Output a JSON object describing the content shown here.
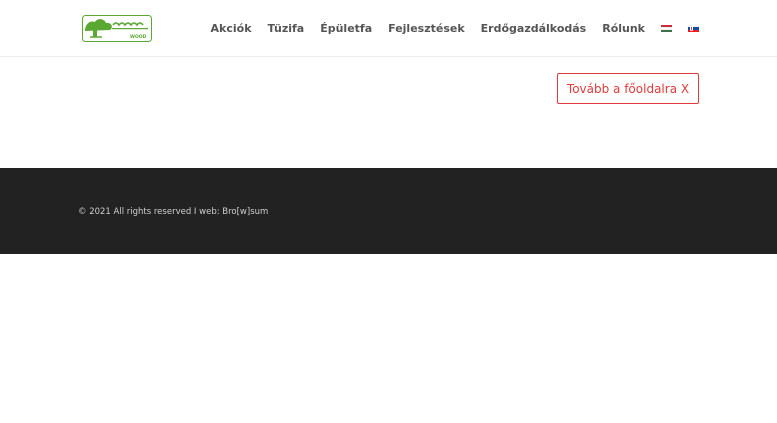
{
  "header": {
    "logo_alt": "Wood",
    "nav": {
      "items": [
        {
          "label": "Akciók"
        },
        {
          "label": "Tüzifa"
        },
        {
          "label": "Épületfa"
        },
        {
          "label": "Fejlesztések"
        },
        {
          "label": "Erdőgazdálkodás"
        },
        {
          "label": "Rólunk"
        }
      ],
      "flags": [
        {
          "icon": "hungary-flag-icon",
          "colors": [
            "#cd2a3e",
            "#ffffff",
            "#436f4d"
          ]
        },
        {
          "icon": "slovakia-flag-icon",
          "colors": [
            "#ffffff",
            "#0b4ea2",
            "#ee1c25"
          ]
        }
      ]
    }
  },
  "main": {
    "cta_label": "Tovább a főoldalra X"
  },
  "footer": {
    "copyright": "© 2021 All rights reserved I web: Bro[w]sum"
  },
  "colors": {
    "accent": "#e03a3a",
    "logo_green": "#5aa832",
    "footer_bg": "#222222",
    "nav_text": "#555555"
  }
}
